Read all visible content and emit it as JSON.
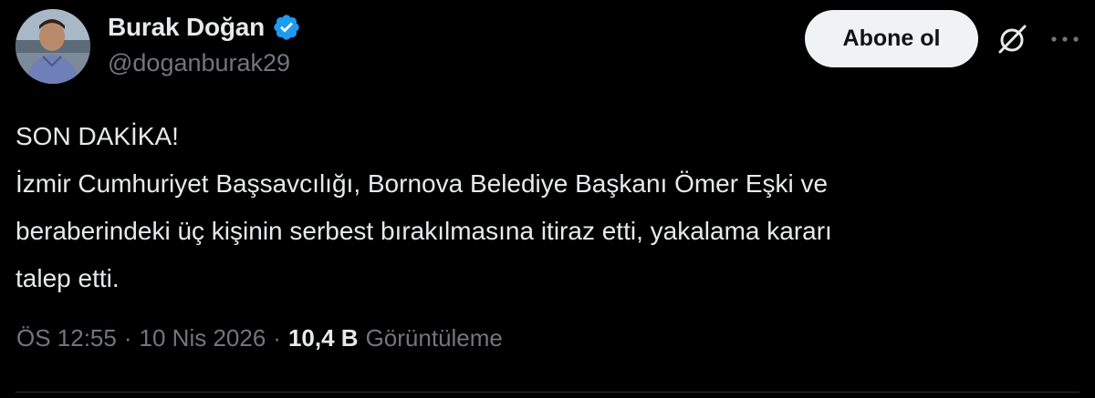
{
  "author": {
    "display_name": "Burak Doğan",
    "handle": "@doganburak29",
    "verified": true
  },
  "actions": {
    "subscribe_label": "Abone ol"
  },
  "tweet": {
    "text": "SON DAKİKA!\nİzmir Cumhuriyet Başsavcılığı, Bornova Belediye Başkanı Ömer Eşki ve\nberaberindeki üç kişinin serbest bırakılmasına itiraz etti, yakalama kararı\ntalep etti."
  },
  "meta": {
    "time": "ÖS 12:55",
    "separator": "·",
    "date": "10 Nis 2026",
    "views_count": "10,4 B",
    "views_label": "Görüntüleme"
  },
  "icons": {
    "verified": "verified-badge-icon",
    "grok": "grok-icon",
    "more": "more-options-icon"
  },
  "colors": {
    "background": "#000000",
    "text_primary": "#e7e9ea",
    "text_secondary": "#71767b",
    "verified_blue": "#1d9bf0",
    "button_bg": "#eff3f4",
    "divider": "#2f3336"
  }
}
